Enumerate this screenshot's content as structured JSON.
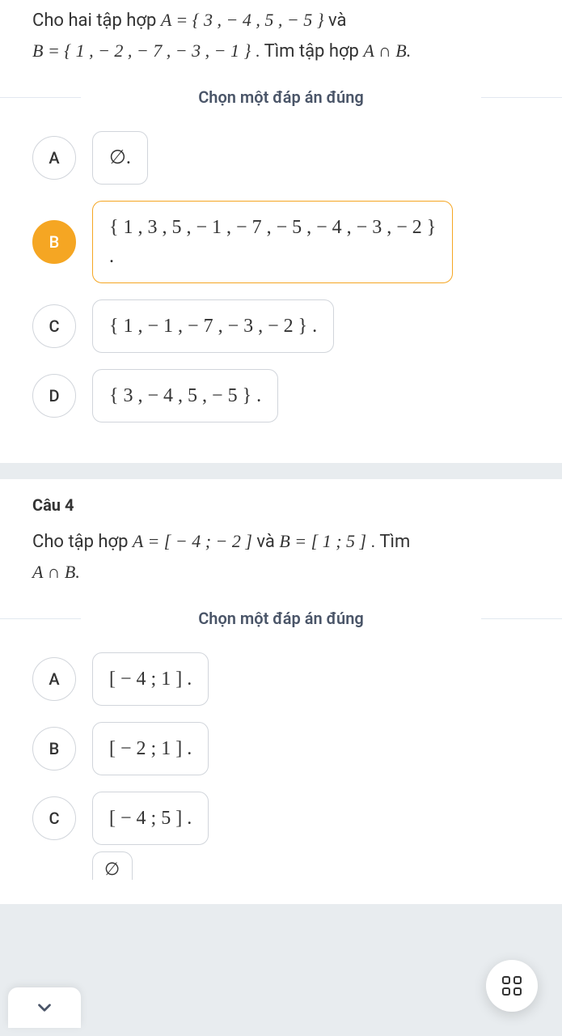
{
  "q3": {
    "prompt_part1": "Cho hai tập hợp ",
    "setA": "A = { 3 , − 4 , 5 , − 5 }",
    "joiner1": " và",
    "setB": "B = { 1 , − 2 , − 7 , − 3 , − 1 }",
    "prompt_part2": ". Tìm tập hợp ",
    "target": "A ∩ B.",
    "instruction": "Chọn một đáp án đúng",
    "options": {
      "A": {
        "letter": "A",
        "text": "∅."
      },
      "B": {
        "letter": "B",
        "text": "{ 1 , 3 , 5 , − 1 , − 7 , − 5 , − 4 , − 3 , − 2 }",
        "dot": "."
      },
      "C": {
        "letter": "C",
        "text": "{ 1 , − 1 , − 7 , − 3 , − 2 } ."
      },
      "D": {
        "letter": "D",
        "text": "{ 3 , − 4 , 5 , − 5 } ."
      }
    },
    "selected": "B"
  },
  "q4": {
    "header": "Câu 4",
    "prompt_part1": "Cho tập hợp ",
    "setA": "A = [ − 4 ; − 2 ]",
    "joiner1": " và ",
    "setB": "B = [ 1 ; 5 ]",
    "prompt_part2": " . Tìm",
    "target": "A ∩ B.",
    "instruction": "Chọn một đáp án đúng",
    "options": {
      "A": {
        "letter": "A",
        "text": "[ − 4 ; 1 ] ."
      },
      "B": {
        "letter": "B",
        "text": "[ − 2 ; 1 ] ."
      },
      "C": {
        "letter": "C",
        "text": "[ − 4 ; 5 ] ."
      }
    },
    "partial": "∅"
  }
}
